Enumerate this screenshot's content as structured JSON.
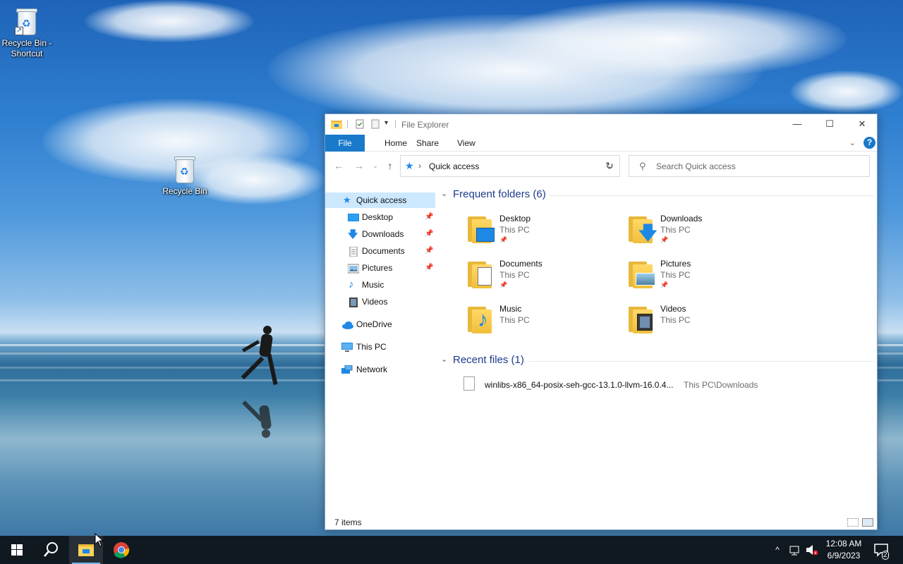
{
  "desktop": {
    "icons": [
      {
        "label": "Recycle Bin - Shortcut"
      },
      {
        "label": "Recycle Bin"
      }
    ]
  },
  "explorer": {
    "title": "File Explorer",
    "ribbon_tabs": [
      "File",
      "Home",
      "Share",
      "View"
    ],
    "help_label": "?",
    "address": {
      "path": "Quick access",
      "separator": "›"
    },
    "search": {
      "placeholder": "Search Quick access"
    },
    "nav": {
      "quick_access": "Quick access",
      "pinned": [
        "Desktop",
        "Downloads",
        "Documents",
        "Pictures"
      ],
      "unpinned": [
        "Music",
        "Videos"
      ],
      "onedrive": "OneDrive",
      "this_pc": "This PC",
      "network": "Network"
    },
    "frequent": {
      "heading": "Frequent folders (6)",
      "folders": [
        {
          "name": "Desktop",
          "location": "This PC",
          "pinned": true,
          "overlay": "desktop"
        },
        {
          "name": "Downloads",
          "location": "This PC",
          "pinned": true,
          "overlay": "download"
        },
        {
          "name": "Documents",
          "location": "This PC",
          "pinned": true,
          "overlay": "document"
        },
        {
          "name": "Pictures",
          "location": "This PC",
          "pinned": true,
          "overlay": "picture"
        },
        {
          "name": "Music",
          "location": "This PC",
          "pinned": false,
          "overlay": "music"
        },
        {
          "name": "Videos",
          "location": "This PC",
          "pinned": false,
          "overlay": "video"
        }
      ]
    },
    "recent": {
      "heading": "Recent files (1)",
      "files": [
        {
          "name": "winlibs-x86_64-posix-seh-gcc-13.1.0-llvm-16.0.4...",
          "location": "This PC\\Downloads"
        }
      ]
    },
    "status": {
      "items": "7 items"
    }
  },
  "taskbar": {
    "time": "12:08 AM",
    "date": "6/9/2023",
    "notification_count": "2"
  },
  "colors": {
    "accent": "#1979ca",
    "selection": "#cce8ff",
    "heading": "#1e3b8a",
    "taskbar": "#101820"
  }
}
